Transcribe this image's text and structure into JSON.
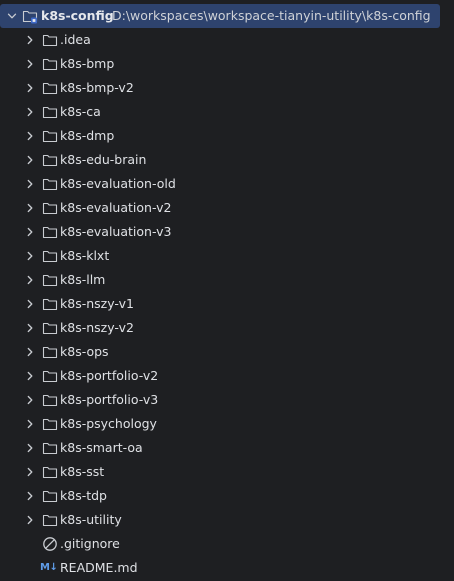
{
  "project": {
    "name": "k8s-config",
    "path": "D:\\workspaces\\workspace-tianyin-utility\\k8s-config",
    "icon": "folder-module-icon"
  },
  "folders": [
    {
      "label": ".idea"
    },
    {
      "label": "k8s-bmp"
    },
    {
      "label": "k8s-bmp-v2"
    },
    {
      "label": "k8s-ca"
    },
    {
      "label": "k8s-dmp"
    },
    {
      "label": "k8s-edu-brain"
    },
    {
      "label": "k8s-evaluation-old"
    },
    {
      "label": "k8s-evaluation-v2"
    },
    {
      "label": "k8s-evaluation-v3"
    },
    {
      "label": "k8s-klxt"
    },
    {
      "label": "k8s-llm"
    },
    {
      "label": "k8s-nszy-v1"
    },
    {
      "label": "k8s-nszy-v2"
    },
    {
      "label": "k8s-ops"
    },
    {
      "label": "k8s-portfolio-v2"
    },
    {
      "label": "k8s-portfolio-v3"
    },
    {
      "label": "k8s-psychology"
    },
    {
      "label": "k8s-smart-oa"
    },
    {
      "label": "k8s-sst"
    },
    {
      "label": "k8s-tdp"
    },
    {
      "label": "k8s-utility"
    }
  ],
  "files": [
    {
      "label": ".gitignore",
      "icon": "ignored-file-icon"
    },
    {
      "label": "README.md",
      "icon": "markdown-icon",
      "badge": "M↓"
    }
  ],
  "colors": {
    "background": "#1e1f22",
    "selection": "#2e436e",
    "text": "#dfe1e5",
    "markdown": "#5f9ce8"
  }
}
